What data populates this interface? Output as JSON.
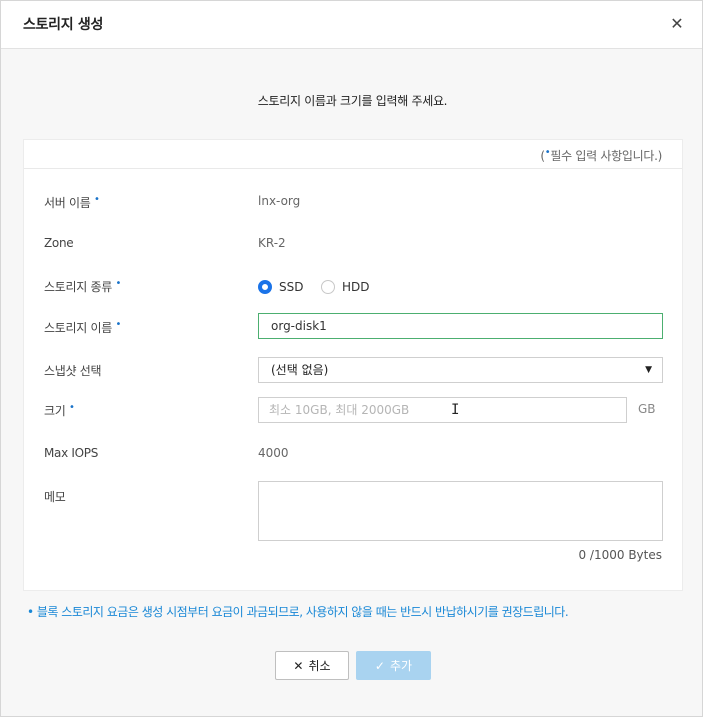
{
  "dialog": {
    "title": "스토리지 생성",
    "close_icon": "close-icon",
    "intro": "스토리지 이름과 크기를 입력해 주세요.",
    "required_note_open": "(",
    "required_note_dot": "•",
    "required_note_text": "필수 입력 사항입니다.)"
  },
  "form": {
    "required_mark": "•",
    "server_name": {
      "label": "서버 이름",
      "value": "lnx-org"
    },
    "zone": {
      "label": "Zone",
      "value": "KR-2"
    },
    "storage_type": {
      "label": "스토리지 종류",
      "options": [
        {
          "label": "SSD",
          "selected": true
        },
        {
          "label": "HDD",
          "selected": false
        }
      ]
    },
    "storage_name": {
      "label": "스토리지 이름",
      "value": "org-disk1"
    },
    "snapshot": {
      "label": "스냅샷 선택",
      "selected": "(선택 없음)",
      "caret": "▼"
    },
    "size": {
      "label": "크기",
      "placeholder": "최소 10GB, 최대 2000GB",
      "unit": "GB",
      "cursor": "I"
    },
    "max_iops": {
      "label": "Max IOPS",
      "value": "4000"
    },
    "memo": {
      "label": "메모",
      "value": "",
      "counter": "0 /1000 Bytes"
    }
  },
  "notice": "•  블록 스토리지 요금은 생성 시점부터 요금이 과금되므로, 사용하지 않을 때는 반드시 반납하시기를 권장드립니다.",
  "buttons": {
    "cancel_icon": "✕",
    "cancel": "취소",
    "add_icon": "✓",
    "add": "추가"
  },
  "colors": {
    "accent": "#1a73e8",
    "notice": "#1a88d6",
    "focus_border": "#4caf70",
    "add_disabled": "#a9d3f0"
  }
}
